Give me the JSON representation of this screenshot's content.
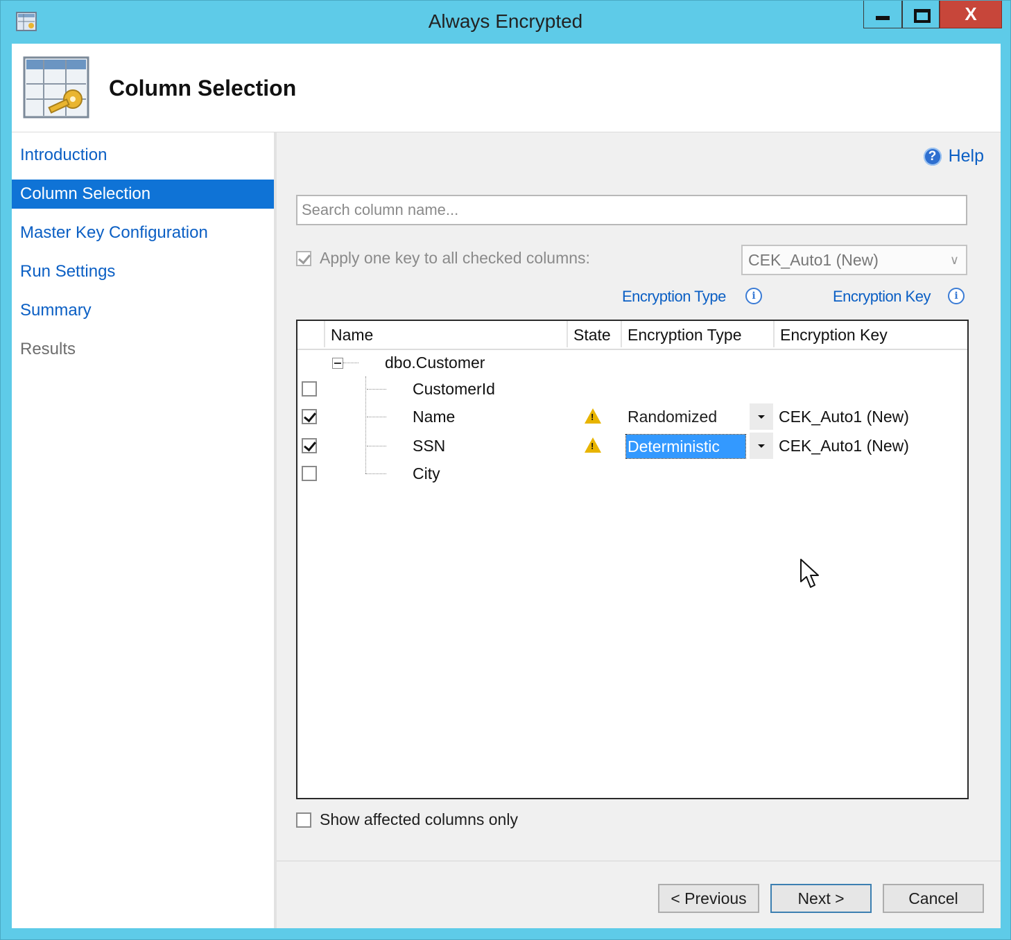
{
  "window": {
    "title": "Always Encrypted",
    "close_glyph": "X"
  },
  "header": {
    "title": "Column Selection"
  },
  "nav": {
    "items": [
      {
        "label": "Introduction",
        "state": "link"
      },
      {
        "label": "Column Selection",
        "state": "active"
      },
      {
        "label": "Master Key Configuration",
        "state": "link"
      },
      {
        "label": "Run Settings",
        "state": "link"
      },
      {
        "label": "Summary",
        "state": "link"
      },
      {
        "label": "Results",
        "state": "disabled"
      }
    ]
  },
  "main": {
    "help_label": "Help",
    "search_placeholder": "Search column name...",
    "apply_one_key_label": "Apply one key to all checked columns:",
    "apply_one_key_checked": true,
    "apply_key_value": "CEK_Auto1 (New)",
    "encryption_type_link": "Encryption Type",
    "encryption_key_link": "Encryption Key",
    "info_glyph": "i",
    "grid": {
      "columns": [
        "Name",
        "State",
        "Encryption Type",
        "Encryption Key"
      ],
      "table": "dbo.Customer",
      "rows": [
        {
          "name": "CustomerId",
          "checked": false,
          "state": "",
          "encryption_type": "",
          "encryption_key": ""
        },
        {
          "name": "Name",
          "checked": true,
          "state": "warning",
          "encryption_type": "Randomized",
          "encryption_key": "CEK_Auto1 (New)"
        },
        {
          "name": "SSN",
          "checked": true,
          "state": "warning",
          "encryption_type": "Deterministic",
          "encryption_key": "CEK_Auto1 (New)"
        },
        {
          "name": "City",
          "checked": false,
          "state": "",
          "encryption_type": "",
          "encryption_key": ""
        }
      ]
    },
    "show_affected_label": "Show affected columns only",
    "show_affected_checked": false
  },
  "footer": {
    "previous_label": "< Previous",
    "next_label": "Next >",
    "cancel_label": "Cancel"
  },
  "colors": {
    "title_bar": "#5ecbe8",
    "link": "#0b5fc4",
    "nav_active": "#0f73d6",
    "close_button": "#c7463a",
    "warning": "#e8b400",
    "selection": "#3399ff"
  }
}
